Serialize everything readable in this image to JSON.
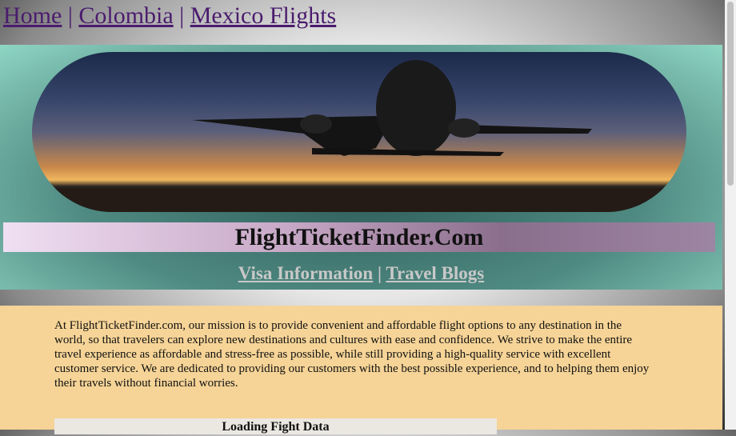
{
  "topnav": {
    "home": "Home",
    "separator": "|",
    "colombia": "Colombia",
    "mexico": "Mexico Flights"
  },
  "hero": {
    "image": "airplane-sunset-photo",
    "site_title": "FlightTicketFinder.Com"
  },
  "subnav": {
    "visa": "Visa Information",
    "separator": "|",
    "blogs": "Travel Blogs"
  },
  "content": {
    "mission": "At FlightTicketFinder.com, our mission is to provide convenient and affordable flight options to any destination in the world, so that travelers can explore new destinations and cultures with ease and confidence. We strive to make the entire travel experience as affordable and stress-free as possible, while still providing a high-quality service with excellent customer service. We are dedicated to providing our customers with the best possible experience, and to helping them enjoy their travels without financial worries.",
    "loading": "Loading Fight Data"
  },
  "colors": {
    "link": "#4b1c6e",
    "content_bg": "#f6d497",
    "hero_bg": "#4f8a82"
  }
}
